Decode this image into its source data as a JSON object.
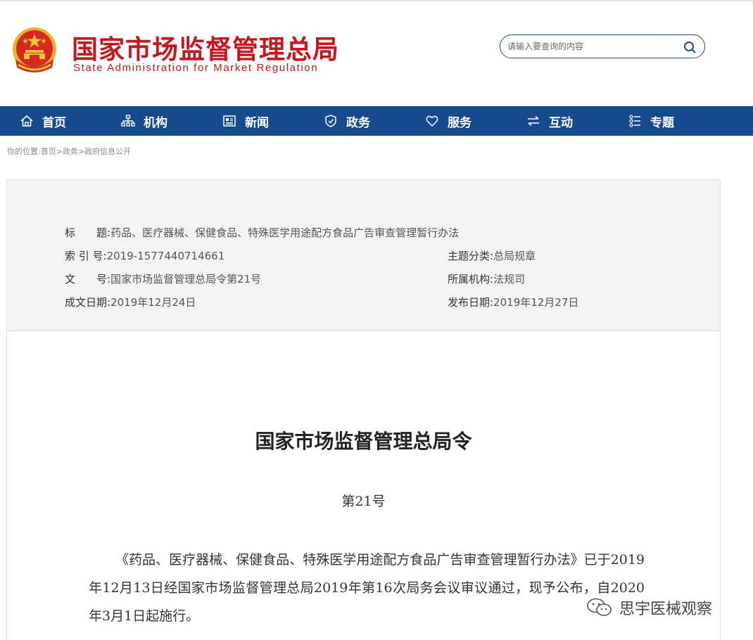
{
  "header": {
    "title_cn": "国家市场监督管理总局",
    "title_en": "State Administration for Market Regulation",
    "search_placeholder": "请输入要查询的内容"
  },
  "nav": [
    {
      "label": "首页",
      "icon": "home-icon"
    },
    {
      "label": "机构",
      "icon": "org-chart-icon"
    },
    {
      "label": "新闻",
      "icon": "news-icon"
    },
    {
      "label": "政务",
      "icon": "shield-icon"
    },
    {
      "label": "服务",
      "icon": "heart-icon"
    },
    {
      "label": "互动",
      "icon": "exchange-icon"
    },
    {
      "label": "专题",
      "icon": "topics-icon"
    }
  ],
  "breadcrumb": {
    "prefix": "你的位置:",
    "items": [
      "首页",
      "政务",
      "政府信息公开"
    ],
    "sep": ">"
  },
  "meta": {
    "title_label": "标　　题:",
    "title_value": "药品、医疗器械、保健食品、特殊医学用途配方食品广告审查管理暂行办法",
    "index_label": "索 引 号:",
    "index_value": "2019-1577440714661",
    "category_label": "主题分类:",
    "category_value": "总局规章",
    "doc_label": "文　　号:",
    "doc_value": "国家市场监督管理总局令第21号",
    "org_label": "所属机构:",
    "org_value": "法规司",
    "date_label": "成文日期:",
    "date_value": "2019年12月24日",
    "pub_label": "发布日期:",
    "pub_value": "2019年12月27日"
  },
  "document": {
    "title": "国家市场监督管理总局令",
    "number": "第21号",
    "body": "《药品、医疗器械、保健食品、特殊医学用途配方食品广告审查管理暂行办法》已于2019年12月13日经国家市场监督管理总局2019年第16次局务会议审议通过，现予公布，自2020年3月1日起施行。"
  },
  "watermark": {
    "text": "思宇医械观察",
    "icon": "wechat-icon"
  },
  "colors": {
    "brand_red": "#c6171e",
    "nav_blue": "#154a8c"
  }
}
